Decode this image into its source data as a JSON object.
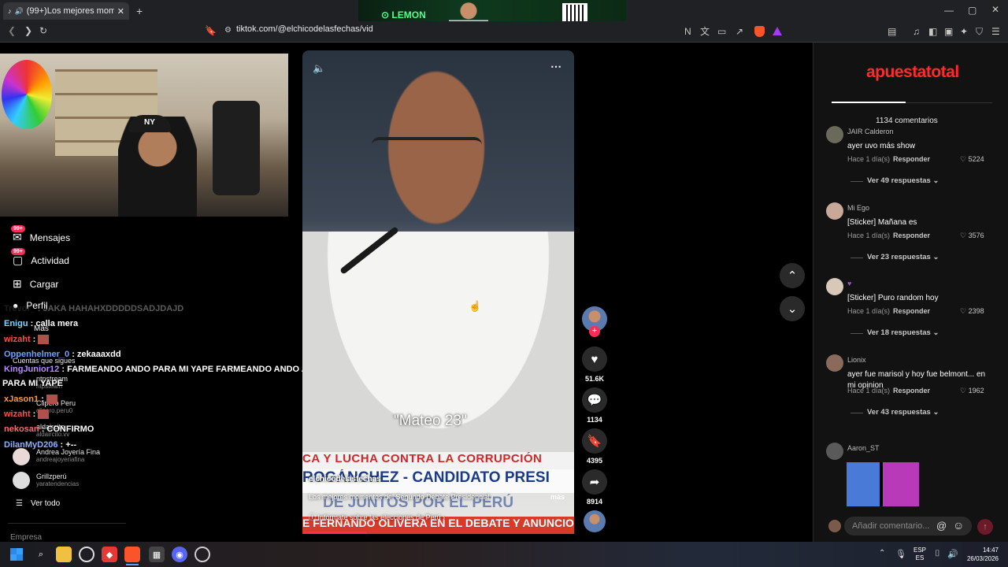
{
  "browser": {
    "tab_title": "(99+)Los mejores momentos",
    "new_tab": "+",
    "url": "tiktok.com/@elchicodelasfechas/vid",
    "ad_brand": "LEMON"
  },
  "sidebar": {
    "items": [
      {
        "label": "Mensajes",
        "badge": "99+"
      },
      {
        "label": "Actividad",
        "badge": "99+"
      },
      {
        "label": "Cargar"
      },
      {
        "label": "Perfil"
      },
      {
        "label": "Más"
      }
    ],
    "following_title": "Cuentas que sigues",
    "following": [
      {
        "name": "ntpstream",
        "handle": "ntpsteam"
      },
      {
        "name": "Clipero Peru",
        "handle": "clipero.peru0"
      },
      {
        "name": "aldaircito",
        "handle": "aldaircito.vv"
      },
      {
        "name": "Andrea Joyería Fina",
        "handle": "andreajoyeriafina"
      },
      {
        "name": "Grillzperú",
        "handle": "yaratendencias"
      }
    ],
    "see_all": "Ver todo",
    "company": "Empresa"
  },
  "chat": [
    {
      "user": "Trevor_",
      "text": "JAKA HAHAHXDDDDDSADJDAJD",
      "color": "#555555"
    },
    {
      "user": "Enigu",
      "text": "calla mera",
      "color": "#7fd7ff"
    },
    {
      "user": "wizaht",
      "text": "",
      "color": "#ff4d4d"
    },
    {
      "user": "Oppenhelmer_0",
      "text": "zekaaaxdd",
      "color": "#6fa0ff"
    },
    {
      "user": "KingJunior12",
      "text": "FARMEANDO ANDO PARA MI YAPE FARMEANDO ANDO ANDO",
      "color": "#b98cff"
    },
    {
      "user": "",
      "text": "PARA MI YAPE",
      "color": "#ffffff"
    },
    {
      "user": "xJason1",
      "text": "",
      "color": "#ff9a3c"
    },
    {
      "user": "wizaht",
      "text": "",
      "color": "#ff4d4d"
    },
    {
      "user": "nekosan",
      "text": "CONFIRMO",
      "color": "#ff6a6a"
    },
    {
      "user": "DilanMyD206",
      "text": "+--",
      "color": "#8fb0ff"
    }
  ],
  "video": {
    "caption": "\"Mateo 23\"",
    "banner_top": "CA Y LUCHA CONTRA LA CORRUPCIÓN",
    "banner_mid": "ROGÁNCHEZ - CANDIDATO PRESI",
    "banner_mid2": "DE JUNTOS POR EL PERÚ",
    "banner_bottom": "E FERNANDO OLIVERA EN EL DEBATE Y ANUNCIO",
    "author": "elchicodelasfechas",
    "description": "Los mejores momentos del Segundo Debate Presidencial",
    "more": "más",
    "info_link": "Infórmate sobre las elecciones de Perú",
    "likes": "51.6K",
    "comments": "1134",
    "saves": "4395",
    "shares": "8914"
  },
  "comments_panel": {
    "sponsor": "apuestatotal",
    "count_label": "1134 comentarios",
    "items": [
      {
        "user": "JAIR Calderon",
        "text": "ayer uvo más show",
        "time": "Hace 1 día(s)",
        "likes": "5224",
        "replies": "Ver 49 respuestas"
      },
      {
        "user": "Mi Ego",
        "text": "[Sticker] Mañana es",
        "time": "Hace 1 día(s)",
        "likes": "3576",
        "replies": "Ver 23 respuestas"
      },
      {
        "user": "",
        "text": "[Sticker] Puro random hoy",
        "time": "Hace 1 día(s)",
        "likes": "2398",
        "replies": "Ver 18 respuestas"
      },
      {
        "user": "Lionix",
        "text": "ayer fue marisol y hoy fue belmont... en mi opinion",
        "time": "Hace 1 día(s)",
        "likes": "1962",
        "replies": "Ver 43 respuestas"
      },
      {
        "user": "Aaron_ST",
        "text": "",
        "time": "",
        "likes": "",
        "replies": ""
      }
    ],
    "reply_label": "Responder",
    "input_placeholder": "Añadir comentario..."
  },
  "taskbar": {
    "lang1": "ESP",
    "lang2": "ES",
    "time": "14:47",
    "date": "26/03/2026"
  }
}
